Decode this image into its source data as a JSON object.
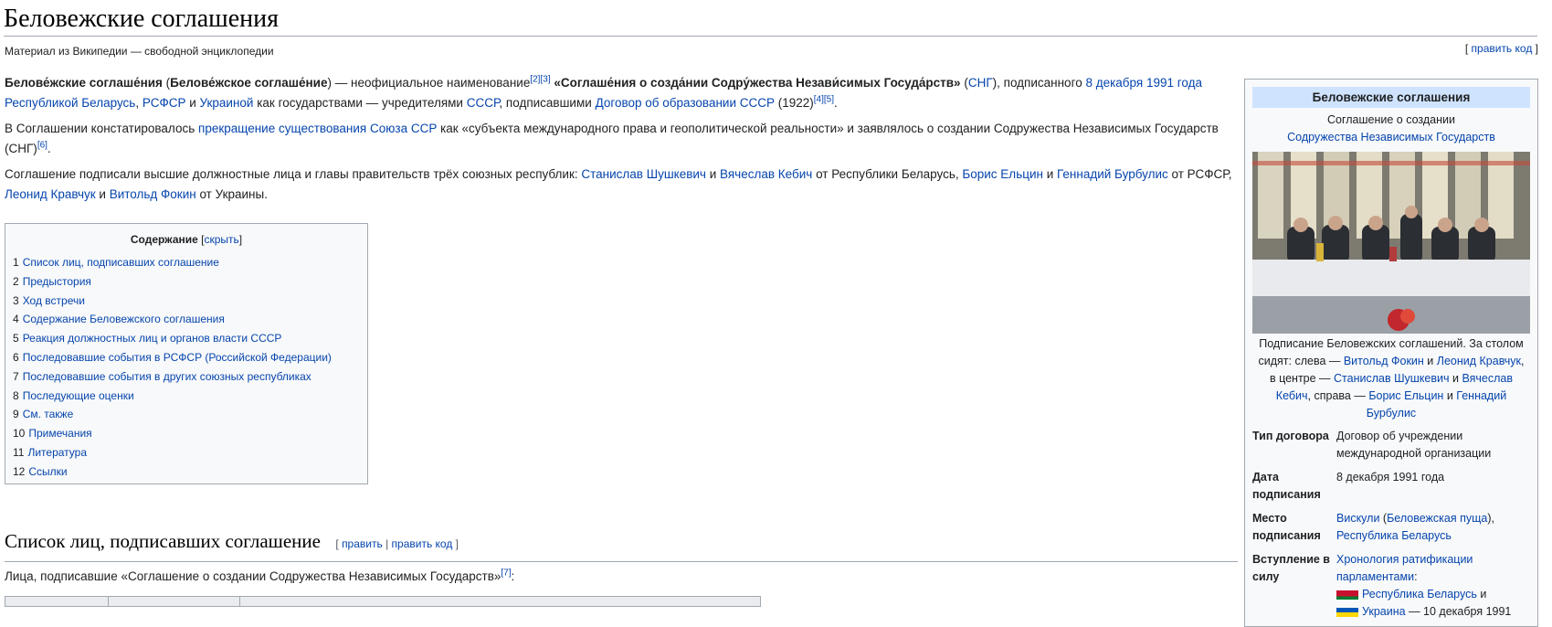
{
  "title": "Беловежские соглашения",
  "tagline": "Материал из Википедии — свободной энциклопедии",
  "edit_top": {
    "open": "[ ",
    "label": "править код",
    "close": " ]"
  },
  "para1": {
    "t1": "Белове́жские соглаше́ния",
    "t2": " (",
    "t3": "Белове́жское соглаше́ние",
    "t4": ") — неофициальное наименование",
    "ref1": "[2]",
    "ref2": "[3]",
    "t5": " ",
    "t6": "«Соглаше́ния о созда́нии Содру́жества Незави́симых Госуда́рств»",
    "t7": " (",
    "l1": "СНГ",
    "t8": "), подписанного ",
    "l2": "8 декабря 1991 года",
    "t9": " ",
    "l3": "Республикой Беларусь",
    "t10": ", ",
    "l4": "РСФСР",
    "t11": " и ",
    "l5": "Украиной",
    "t12": " как государствами — учредителями ",
    "l6": "СССР",
    "t13": ", подписавшими ",
    "l7": "Договор об образовании СССР",
    "t14": " (1922)",
    "ref3": "[4]",
    "ref4": "[5]",
    "t15": "."
  },
  "para2": {
    "t1": "В Соглашении констатировалось ",
    "l1": "прекращение существования Союза ССР",
    "t2": " как «субъекта международного права и геополитической реальности» и заявлялось о создании Содружества Независимых Государств (СНГ)",
    "ref1": "[6]",
    "t3": "."
  },
  "para3": {
    "t1": "Соглашение подписали высшие должностные лица и главы правительств трёх союзных республик: ",
    "l1": "Станислав Шушкевич",
    "t2": " и ",
    "l2": "Вячеслав Кебич",
    "t3": " от Республики Беларусь, ",
    "l3": "Борис Ельцин",
    "t4": " и ",
    "l4": "Геннадий Бурбулис",
    "t5": " от РСФСР, ",
    "l5": "Леонид Кравчук",
    "t6": " и ",
    "l6": "Витольд Фокин",
    "t7": " от Украины."
  },
  "toc": {
    "heading": "Содержание",
    "open": " [",
    "toggle": "скрыть",
    "close": "]",
    "items": [
      {
        "num": "1",
        "label": "Список лиц, подписавших соглашение"
      },
      {
        "num": "2",
        "label": "Предыстория"
      },
      {
        "num": "3",
        "label": "Ход встречи"
      },
      {
        "num": "4",
        "label": "Содержание Беловежского соглашения"
      },
      {
        "num": "5",
        "label": "Реакция должностных лиц и органов власти СССР"
      },
      {
        "num": "6",
        "label": "Последовавшие события в РСФСР (Российской Федерации)"
      },
      {
        "num": "7",
        "label": "Последовавшие события в других союзных республиках"
      },
      {
        "num": "8",
        "label": "Последующие оценки"
      },
      {
        "num": "9",
        "label": "См. также"
      },
      {
        "num": "10",
        "label": "Примечания"
      },
      {
        "num": "11",
        "label": "Литература"
      },
      {
        "num": "12",
        "label": "Ссылки"
      }
    ]
  },
  "section": {
    "title": "Список лиц, подписавших соглашение",
    "open": "[ ",
    "edit": "править",
    "sep": " | ",
    "edit_code": "править код",
    "close": " ]",
    "text": "Лица, подписавшие «Соглашение о создании Содружества Независимых Государств»",
    "ref": "[7]",
    "tail": ":"
  },
  "infobox": {
    "title": "Беловежские соглашения",
    "sub1": "Соглашение о создании",
    "sub2": "Содружества Независимых Государств",
    "caption": {
      "t1": "Подписание Беловежских соглашений. За столом сидят: слева — ",
      "l1": "Витольд Фокин",
      "t2": " и ",
      "l2": "Леонид Кравчук",
      "t3": ", в центре — ",
      "l3": "Станислав Шушкевич",
      "t4": " и ",
      "l4": "Вячеслав Кебич",
      "t5": ", справа — ",
      "l5": "Борис Ельцин",
      "t6": " и ",
      "l6": "Геннадий Бурбулис"
    },
    "rows": {
      "type_label": "Тип договора",
      "type_value": "Договор об учреждении международной организации",
      "date_label": "Дата подписания",
      "date_value": "8 декабря 1991 года",
      "place_label": "Место подписания",
      "place_l1": "Вискули",
      "place_t1": " (",
      "place_l2": "Беловежская пуща",
      "place_t2": "),",
      "place_l3": "Республика Беларусь",
      "force_label": "Вступление в силу",
      "force_l1": "Хронология ратификации парламентами",
      "force_t1": ":",
      "force_c1": "Республика Беларусь",
      "force_t2": " и",
      "force_c2": "Украина",
      "force_t3": " — 10 декабря 1991"
    }
  },
  "colors": {
    "link": "#0645ad",
    "flag_by_red": "#c8102e",
    "flag_by_green": "#007c30",
    "flag_ua_blue": "#0057b7",
    "flag_ua_yellow": "#ffd700"
  }
}
